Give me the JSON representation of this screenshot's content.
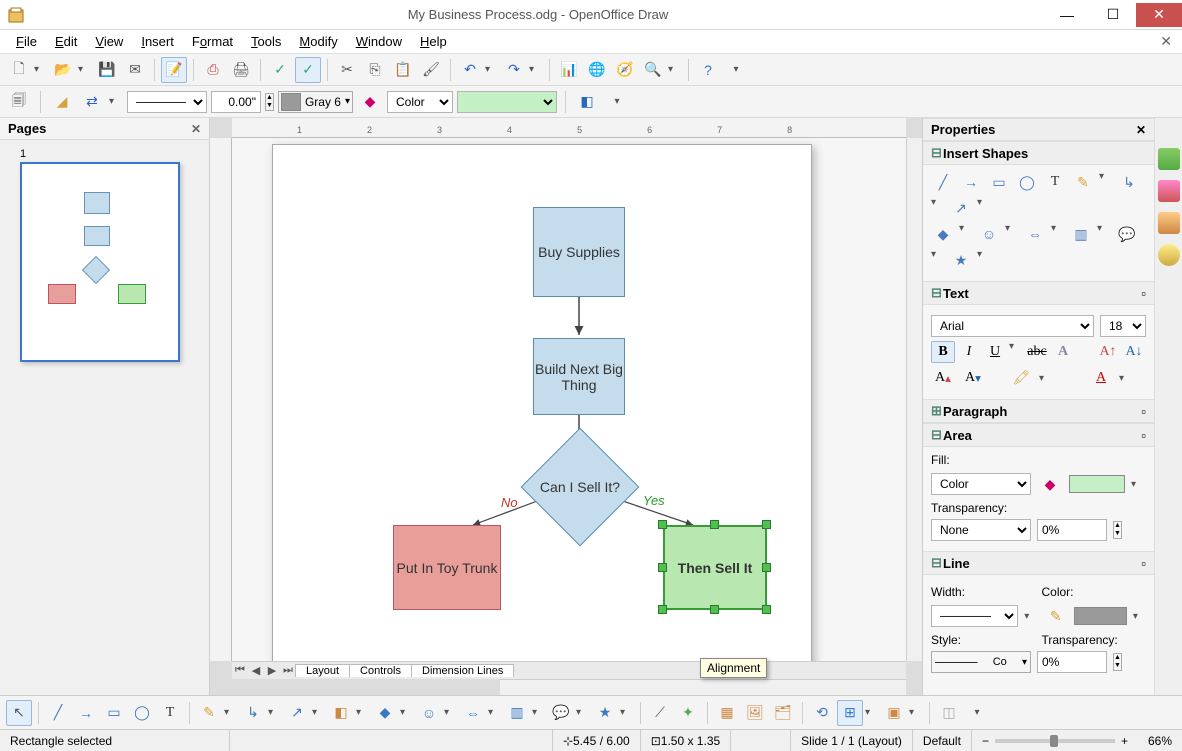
{
  "window": {
    "title": "My Business Process.odg - OpenOffice Draw"
  },
  "menu": {
    "file": "File",
    "edit": "Edit",
    "view": "View",
    "insert": "Insert",
    "format": "Format",
    "tools": "Tools",
    "modify": "Modify",
    "window": "Window",
    "help": "Help"
  },
  "toolbar2": {
    "lineWidth": "0.00\"",
    "lineColor": "Gray 6",
    "fillMode": "Color"
  },
  "pages": {
    "title": "Pages",
    "pageNum": "1"
  },
  "tabs": {
    "layout": "Layout",
    "controls": "Controls",
    "dimension": "Dimension Lines"
  },
  "tooltip": "Alignment",
  "shapes": {
    "buy": "Buy Supplies",
    "build": "Build Next Big Thing",
    "decide": "Can I Sell It?",
    "no": "No",
    "yes": "Yes",
    "put": "Put In Toy Trunk",
    "sell": "Then Sell It"
  },
  "properties": {
    "title": "Properties",
    "insertShapes": "Insert Shapes",
    "text": "Text",
    "font": "Arial",
    "size": "18",
    "paragraph": "Paragraph",
    "area": "Area",
    "fillLbl": "Fill:",
    "fillMode": "Color",
    "transLbl": "Transparency:",
    "transMode": "None",
    "transVal": "0%",
    "line": "Line",
    "widthLbl": "Width:",
    "colorLbl": "Color:",
    "styleLbl": "Style:",
    "styleVal": "Co",
    "lineTransVal": "0%"
  },
  "status": {
    "sel": "Rectangle selected",
    "pos": "5.45 / 6.00",
    "size": "1.50 x 1.35",
    "slide": "Slide 1 / 1 (Layout)",
    "style": "Default",
    "zoom": "66%"
  }
}
